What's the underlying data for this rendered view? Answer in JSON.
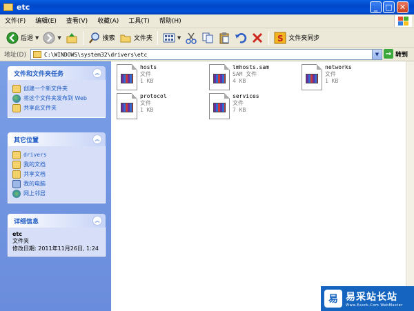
{
  "window": {
    "title": "etc"
  },
  "menu": [
    "文件(F)",
    "编辑(E)",
    "查看(V)",
    "收藏(A)",
    "工具(T)",
    "帮助(H)"
  ],
  "toolbar": {
    "back": "后退",
    "search": "搜索",
    "folders": "文件夹",
    "sync": "文件夹同步"
  },
  "address": {
    "label": "地址(D)",
    "path": "C:\\WINDOWS\\system32\\drivers\\etc",
    "go": "转到"
  },
  "tasks": {
    "title": "文件和文件夹任务",
    "items": [
      {
        "label": "创建一个新文件夹",
        "icon": "new-folder-icon"
      },
      {
        "label": "将这个文件夹发布到 Web",
        "icon": "publish-web-icon"
      },
      {
        "label": "共享此文件夹",
        "icon": "share-folder-icon"
      }
    ]
  },
  "places": {
    "title": "其它位置",
    "items": [
      {
        "label": "drivers",
        "icon": "folder-icon"
      },
      {
        "label": "我的文档",
        "icon": "my-documents-icon"
      },
      {
        "label": "共享文档",
        "icon": "shared-documents-icon"
      },
      {
        "label": "我的电脑",
        "icon": "my-computer-icon"
      },
      {
        "label": "网上邻居",
        "icon": "network-places-icon"
      }
    ]
  },
  "details": {
    "title": "详细信息",
    "name": "etc",
    "type": "文件夹",
    "modified": "修改日期: 2011年11月26日, 1:24"
  },
  "files": [
    {
      "name": "hosts",
      "type": "文件",
      "size": "1 KB"
    },
    {
      "name": "lmhosts.sam",
      "type": "SAM 文件",
      "size": "4 KB"
    },
    {
      "name": "networks",
      "type": "文件",
      "size": "1 KB"
    },
    {
      "name": "protocol",
      "type": "文件",
      "size": "1 KB"
    },
    {
      "name": "services",
      "type": "文件",
      "size": "7 KB"
    }
  ],
  "watermark": {
    "title": "易采站长站",
    "url": "Www.Easck.Com WebMaster"
  }
}
